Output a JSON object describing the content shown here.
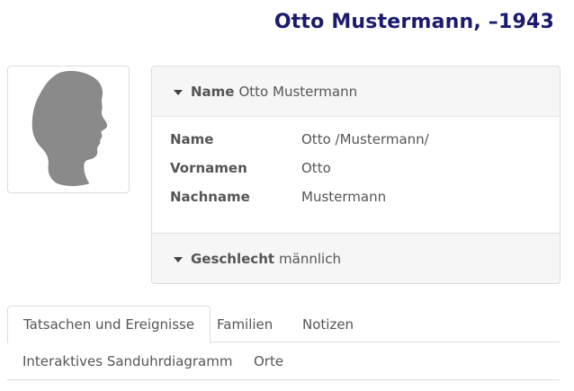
{
  "page": {
    "title": "Otto Mustermann, –1943"
  },
  "photo": {
    "icon": "silhouette-icon"
  },
  "name_section": {
    "label": "Name",
    "value": "Otto Mustermann",
    "rows": [
      {
        "key": "Name",
        "value": "Otto /Mustermann/"
      },
      {
        "key": "Vornamen",
        "value": "Otto"
      },
      {
        "key": "Nachname",
        "value": "Mustermann"
      }
    ]
  },
  "gender_section": {
    "label": "Geschlecht",
    "value": "männlich"
  },
  "tabs": [
    {
      "label": "Tatsachen und Ereignisse",
      "active": true
    },
    {
      "label": "Familien",
      "active": false
    },
    {
      "label": "Notizen",
      "active": false
    },
    {
      "label": "Interaktives Sanduhrdiagramm",
      "active": false
    },
    {
      "label": "Orte",
      "active": false
    }
  ],
  "colors": {
    "title": "#1a1a6e",
    "silhouette": "#8a8a8a"
  }
}
